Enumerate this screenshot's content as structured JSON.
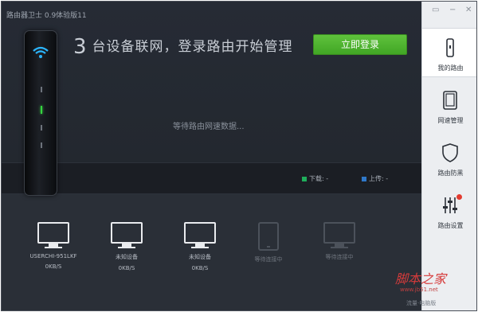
{
  "window": {
    "title": "路由器卫士 0.9体验版11"
  },
  "header": {
    "device_count": "3",
    "headline": "台设备联网，登录路由开始管理",
    "login_button": "立即登录"
  },
  "status": {
    "waiting_text": "等待路由网速数据..."
  },
  "speed": {
    "download_label": "下载: -",
    "upload_label": "上传: -",
    "download_color": "#1fae5b",
    "upload_color": "#2f78c9"
  },
  "devices": [
    {
      "name": "USERCHI-951LKF",
      "rate": "0KB/S",
      "icon": "monitor-icon"
    },
    {
      "name": "未知设备",
      "rate": "0KB/S",
      "icon": "monitor-icon"
    },
    {
      "name": "未知设备",
      "rate": "0KB/S",
      "icon": "monitor-icon"
    },
    {
      "name": "等待连接中",
      "rate": "",
      "icon": "tablet-icon"
    },
    {
      "name": "等待连接中",
      "rate": "",
      "icon": "monitor-icon"
    }
  ],
  "sidebar": {
    "window_controls": [
      "▭",
      "−",
      "✕"
    ],
    "items": [
      {
        "label": "我的路由",
        "icon": "router-icon",
        "active": true
      },
      {
        "label": "网速管理",
        "icon": "tablet-icon",
        "active": false
      },
      {
        "label": "路由防黑",
        "icon": "shield-icon",
        "active": false
      },
      {
        "label": "路由设置",
        "icon": "sliders-icon",
        "active": false,
        "badge": true
      }
    ]
  },
  "watermark": {
    "text": "脚本之家",
    "url": "www.jb51.net"
  },
  "footer": {
    "text": "流量·电脑版"
  }
}
